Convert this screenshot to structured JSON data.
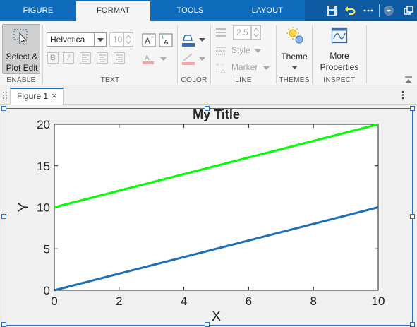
{
  "tabs": [
    {
      "label": "FIGURE"
    },
    {
      "label": "FORMAT"
    },
    {
      "label": "TOOLS"
    },
    {
      "label": "LAYOUT"
    }
  ],
  "quick_access_icons": [
    "save-icon",
    "undo-icon",
    "more-icon",
    "dropdown-icon",
    "undock-icon"
  ],
  "ribbon": {
    "enable": {
      "button_line1": "Select &",
      "button_line2": "Plot Edit",
      "label": "ENABLE"
    },
    "text": {
      "font": "Helvetica",
      "size": "10",
      "label": "TEXT",
      "bold": "B",
      "italic": "/"
    },
    "color": {
      "label": "COLOR"
    },
    "line": {
      "width": "2.5",
      "style": "Style",
      "marker": "Marker",
      "label": "LINE"
    },
    "themes": {
      "button": "Theme",
      "label": "THEMES"
    },
    "inspect": {
      "button_line1": "More",
      "button_line2": "Properties",
      "label": "INSPECT"
    }
  },
  "figure_tab": {
    "label": "Figure 1",
    "close": "×"
  },
  "colors": {
    "accent": "#0f6cbd",
    "series1": "#1f6fb5",
    "series2": "#00ff00"
  },
  "chart_data": {
    "type": "line",
    "title": "My Title",
    "xlabel": "X",
    "ylabel": "Y",
    "xlim": [
      0,
      10
    ],
    "ylim": [
      0,
      20
    ],
    "xticks": [
      0,
      2,
      4,
      6,
      8,
      10
    ],
    "yticks": [
      0,
      5,
      10,
      15,
      20
    ],
    "grid": false,
    "series": [
      {
        "x": [
          0,
          10
        ],
        "y": [
          0,
          10
        ],
        "color": "#1f6fb5"
      },
      {
        "x": [
          0,
          10
        ],
        "y": [
          10,
          20
        ],
        "color": "#00ff00"
      }
    ]
  }
}
